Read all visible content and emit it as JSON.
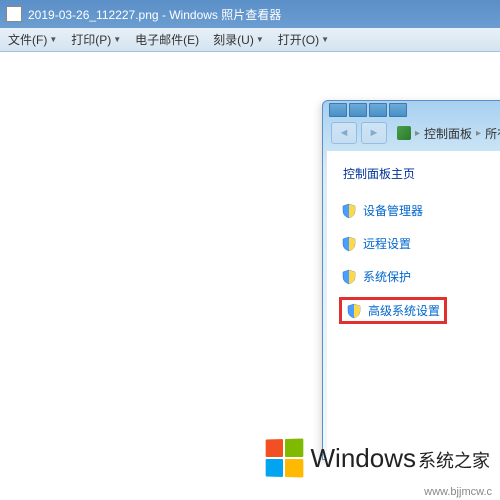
{
  "outer": {
    "title": "2019-03-26_112227.png - Windows 照片查看器",
    "menu": {
      "file": "文件(F)",
      "print": "打印(P)",
      "email": "电子邮件(E)",
      "burn": "刻录(U)",
      "open": "打开(O)"
    }
  },
  "inner": {
    "breadcrumb": {
      "item1": "控制面板",
      "item2": "所有"
    },
    "cp_home": "控制面板主页",
    "links": {
      "device_manager": "设备管理器",
      "remote_settings": "远程设置",
      "system_protection": "系统保护",
      "advanced_system": "高级系统设置"
    }
  },
  "logo": {
    "main": "Windows",
    "sub": "系统之家"
  },
  "watermark": "www.bjjmcw.c"
}
